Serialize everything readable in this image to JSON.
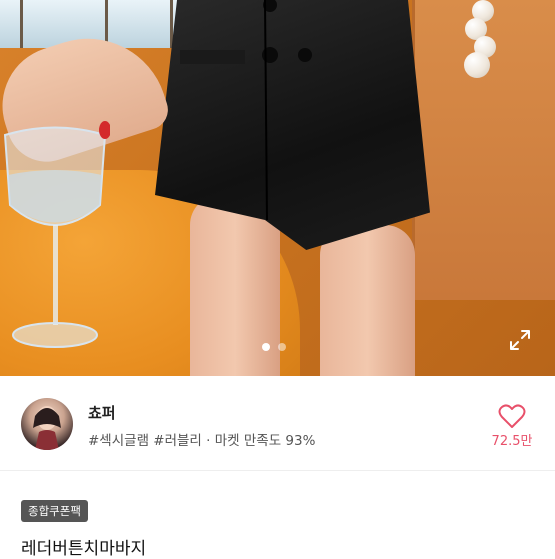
{
  "carousel": {
    "total_images": 2,
    "active_index": 0
  },
  "seller": {
    "name": "쵸퍼",
    "tags_line": "#섹시글램 #러블리 · 마켓 만족도 93%",
    "like_count": "72.5만"
  },
  "product": {
    "badge": "종합쿠폰팩",
    "title": "레더버튼치마바지"
  },
  "icons": {
    "expand": "expand-icon",
    "like": "heart-outline-icon"
  },
  "colors": {
    "accent": "#e8506a",
    "badge_bg": "#555555"
  }
}
